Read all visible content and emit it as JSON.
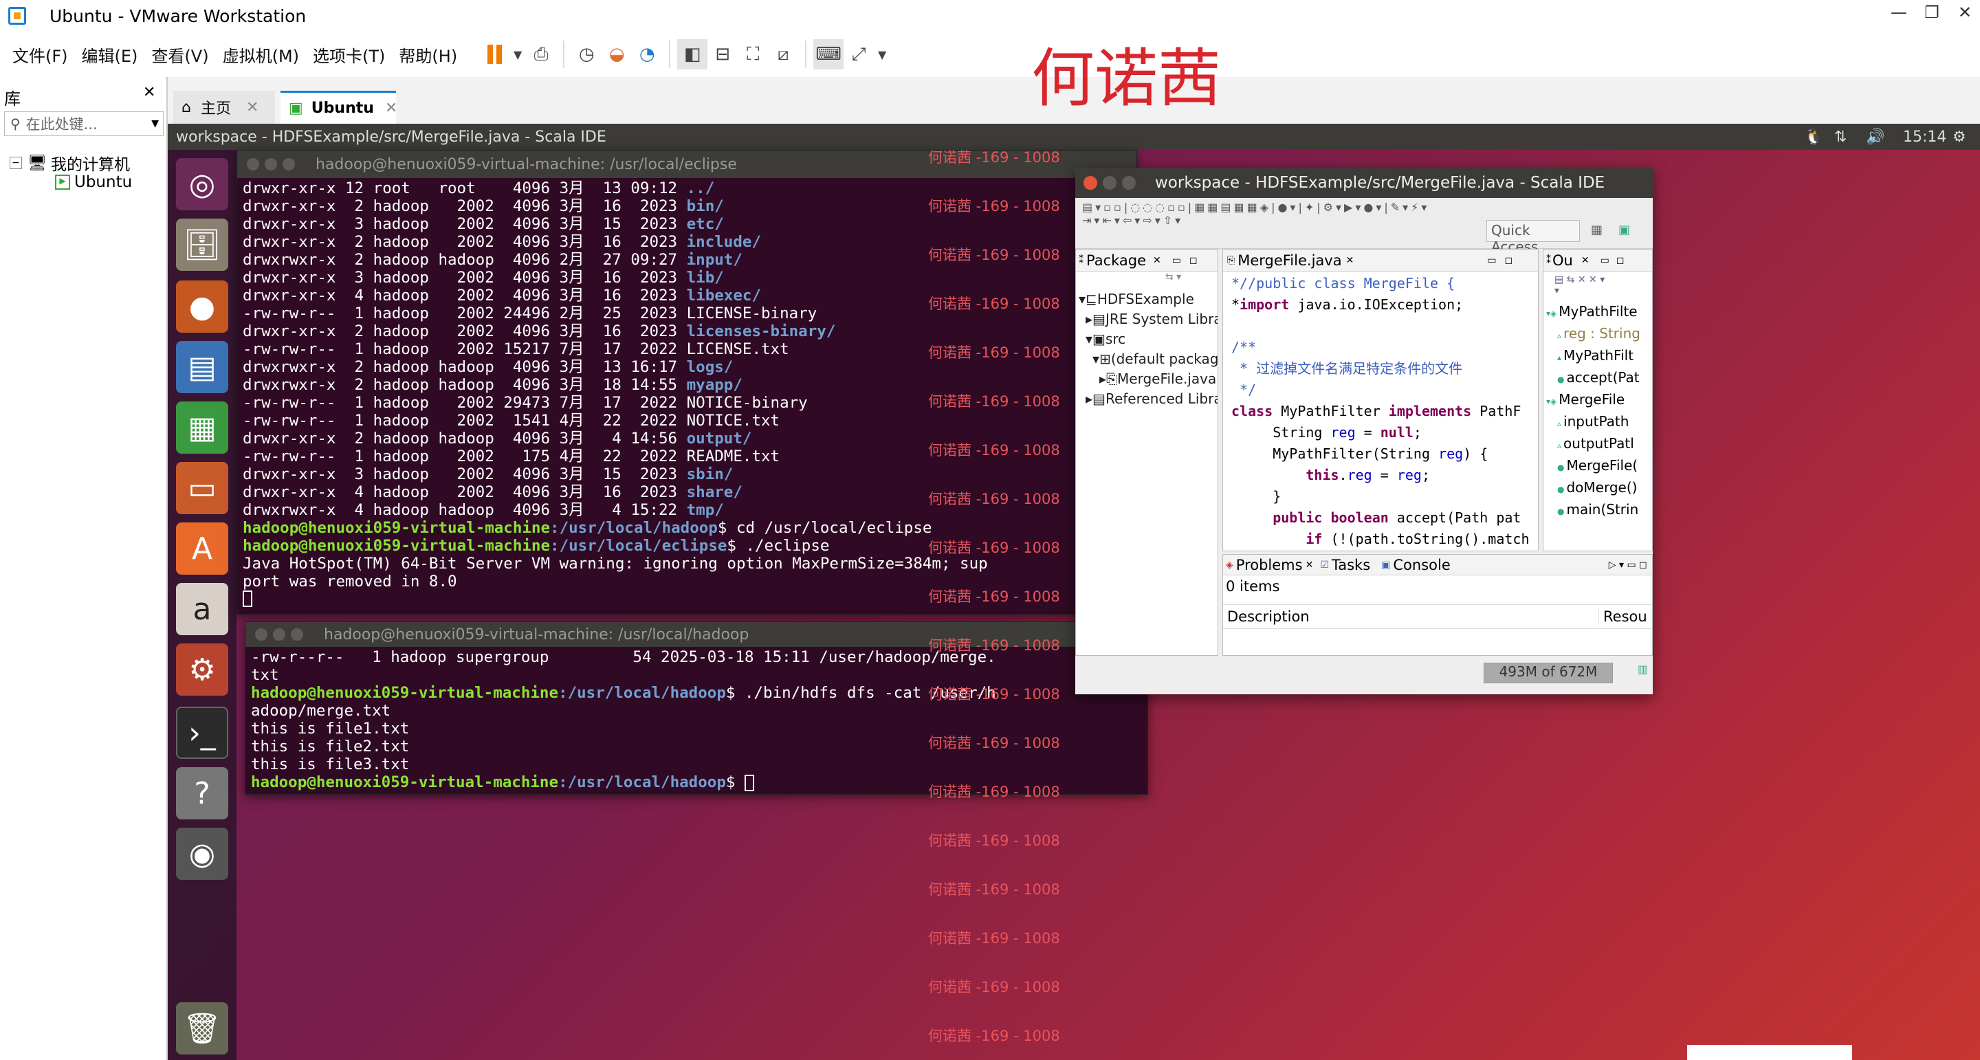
{
  "window": {
    "title": "Ubuntu - VMware Workstation"
  },
  "menu": [
    "文件(F)",
    "编辑(E)",
    "查看(V)",
    "虚拟机(M)",
    "选项卡(T)",
    "帮助(H)"
  ],
  "library": {
    "title": "库",
    "search_placeholder": "在此处键...",
    "tree_root": "我的计算机",
    "tree_child": "Ubuntu"
  },
  "tabs": {
    "home": "主页",
    "ubuntu": "Ubuntu"
  },
  "ubuntu_topbar": {
    "title": "workspace - HDFSExample/src/MergeFile.java - Scala IDE",
    "time": "15:14"
  },
  "watermark": {
    "name": "何诺茜",
    "stamp": "何诺茜 -169 - 1008"
  },
  "terminal1": {
    "title": "hadoop@henuoxi059-virtual-machine: /usr/local/eclipse",
    "listing": [
      [
        "drwxr-xr-x 12 root   root    4096 3月  13 09:12 ",
        "../"
      ],
      [
        "drwxr-xr-x  2 hadoop   2002  4096 3月  16  2023 ",
        "bin/"
      ],
      [
        "drwxr-xr-x  3 hadoop   2002  4096 3月  15  2023 ",
        "etc/"
      ],
      [
        "drwxr-xr-x  2 hadoop   2002  4096 3月  16  2023 ",
        "include/"
      ],
      [
        "drwxrwxr-x  2 hadoop hadoop  4096 2月  27 09:27 ",
        "input/"
      ],
      [
        "drwxr-xr-x  3 hadoop   2002  4096 3月  16  2023 ",
        "lib/"
      ],
      [
        "drwxr-xr-x  4 hadoop   2002  4096 3月  16  2023 ",
        "libexec/"
      ],
      [
        "-rw-rw-r--  1 hadoop   2002 24496 2月  25  2023 LICENSE-binary",
        ""
      ],
      [
        "drwxr-xr-x  2 hadoop   2002  4096 3月  16  2023 ",
        "licenses-binary/"
      ],
      [
        "-rw-rw-r--  1 hadoop   2002 15217 7月  17  2022 LICENSE.txt",
        ""
      ],
      [
        "drwxrwxr-x  2 hadoop hadoop  4096 3月  13 16:17 ",
        "logs/"
      ],
      [
        "drwxrwxr-x  2 hadoop hadoop  4096 3月  18 14:55 ",
        "myapp/"
      ],
      [
        "-rw-rw-r--  1 hadoop   2002 29473 7月  17  2022 NOTICE-binary",
        ""
      ],
      [
        "-rw-rw-r--  1 hadoop   2002  1541 4月  22  2022 NOTICE.txt",
        ""
      ],
      [
        "drwxr-xr-x  2 hadoop hadoop  4096 3月   4 14:56 ",
        "output/"
      ],
      [
        "-rw-rw-r--  1 hadoop   2002   175 4月  22  2022 README.txt",
        ""
      ],
      [
        "drwxr-xr-x  3 hadoop   2002  4096 3月  15  2023 ",
        "sbin/"
      ],
      [
        "drwxr-xr-x  4 hadoop   2002  4096 3月  16  2023 ",
        "share/"
      ],
      [
        "drwxrwxr-x  4 hadoop hadoop  4096 3月   4 15:22 ",
        "tmp/"
      ]
    ],
    "prompt_user": "hadoop@henuoxi059-virtual-machine",
    "cmd1_path": ":/usr/local/hadoop",
    "cmd1": "$ cd /usr/local/eclipse",
    "cmd2_path": ":/usr/local/eclipse",
    "cmd2": "$ ./eclipse",
    "warn1": "Java HotSpot(TM) 64-Bit Server VM warning: ignoring option MaxPermSize=384m; sup",
    "warn2": "port was removed in 8.0"
  },
  "terminal2": {
    "title": "hadoop@henuoxi059-virtual-machine: /usr/local/hadoop",
    "line1": "-rw-r--r--   1 hadoop supergroup         54 2025-03-18 15:11 /user/hadoop/merge.",
    "line2": "txt",
    "prompt_user": "hadoop@henuoxi059-virtual-machine",
    "path": ":/usr/local/hadoop",
    "cmd": "$ ./bin/hdfs dfs -cat /user/h",
    "cmd_wrap": "adoop/merge.txt",
    "out": [
      "this is file1.txt",
      "this is file2.txt",
      "this is file3.txt"
    ],
    "final_cmd": "$ "
  },
  "eclipse": {
    "title": "workspace - HDFSExample/src/MergeFile.java - Scala IDE",
    "quick_access": "Quick Access",
    "package_tab": "Package",
    "tree": [
      "HDFSExample",
      "JRE System Libra",
      "src",
      "(default package",
      "MergeFile.java",
      "Referenced Libra"
    ],
    "editor_tab": "MergeFile.java",
    "code": [
      "*//public class MergeFile {",
      "*import java.io.IOException;",
      "",
      "/**",
      " * 过滤掉文件名满足特定条件的文件",
      " */",
      "class MyPathFilter implements PathF",
      "     String reg = null;",
      "     MyPathFilter(String reg) {",
      "         this.reg = reg;",
      "     }",
      "     public boolean accept(Path pat",
      "         if (!(path.toString().match"
    ],
    "outline_tab": "Ou",
    "outline": [
      "MyPathFilte",
      "reg : String",
      "MyPathFilt",
      "accept(Pat",
      "MergeFile",
      "inputPath",
      "outputPatl",
      "MergeFile(",
      "doMerge()",
      "main(Strin"
    ],
    "problems_tab": "Problems",
    "tasks_tab": "Tasks",
    "console_tab": "Console",
    "items": "0 items",
    "col_desc": "Description",
    "col_res": "Resou",
    "heap": "493M of 672M"
  }
}
